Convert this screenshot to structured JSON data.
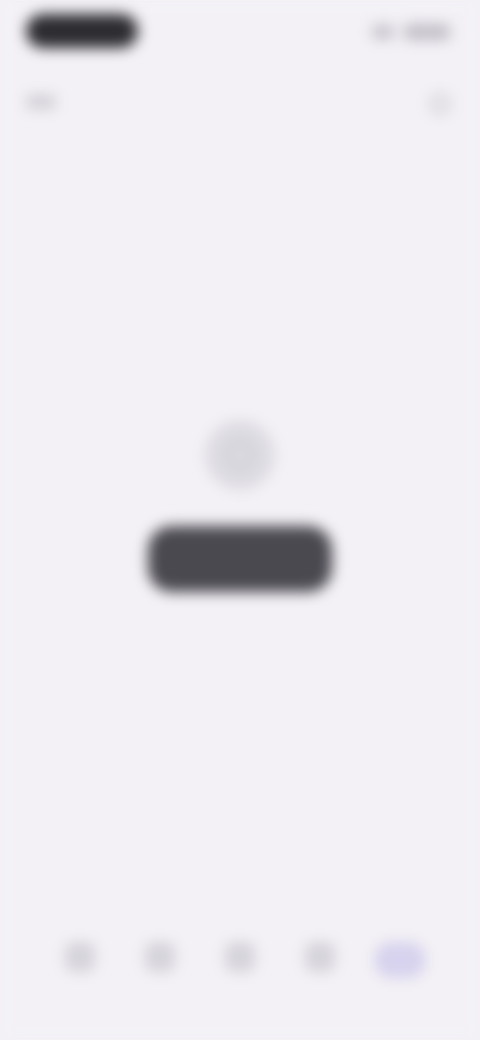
{
  "status_bar": {
    "signal_icon": "signal-icon",
    "battery_icon": "battery-icon"
  },
  "app_bar": {
    "title": "",
    "menu_icon": "menu-icon",
    "search_icon": "search-icon"
  },
  "empty_state": {
    "icon": "empty-state-icon",
    "message": "",
    "button_label": ""
  },
  "bottom_nav": {
    "items": [
      {
        "label": "",
        "icon": "home-icon"
      },
      {
        "label": "",
        "icon": "grid-icon"
      },
      {
        "label": "",
        "icon": "bookmark-icon"
      },
      {
        "label": "",
        "icon": "chat-icon"
      },
      {
        "label": "",
        "icon": "profile-icon",
        "active": true
      }
    ]
  },
  "colors": {
    "background": "#f3f1f5",
    "button": "#4a4950",
    "active_nav": "#d7d2ee"
  }
}
